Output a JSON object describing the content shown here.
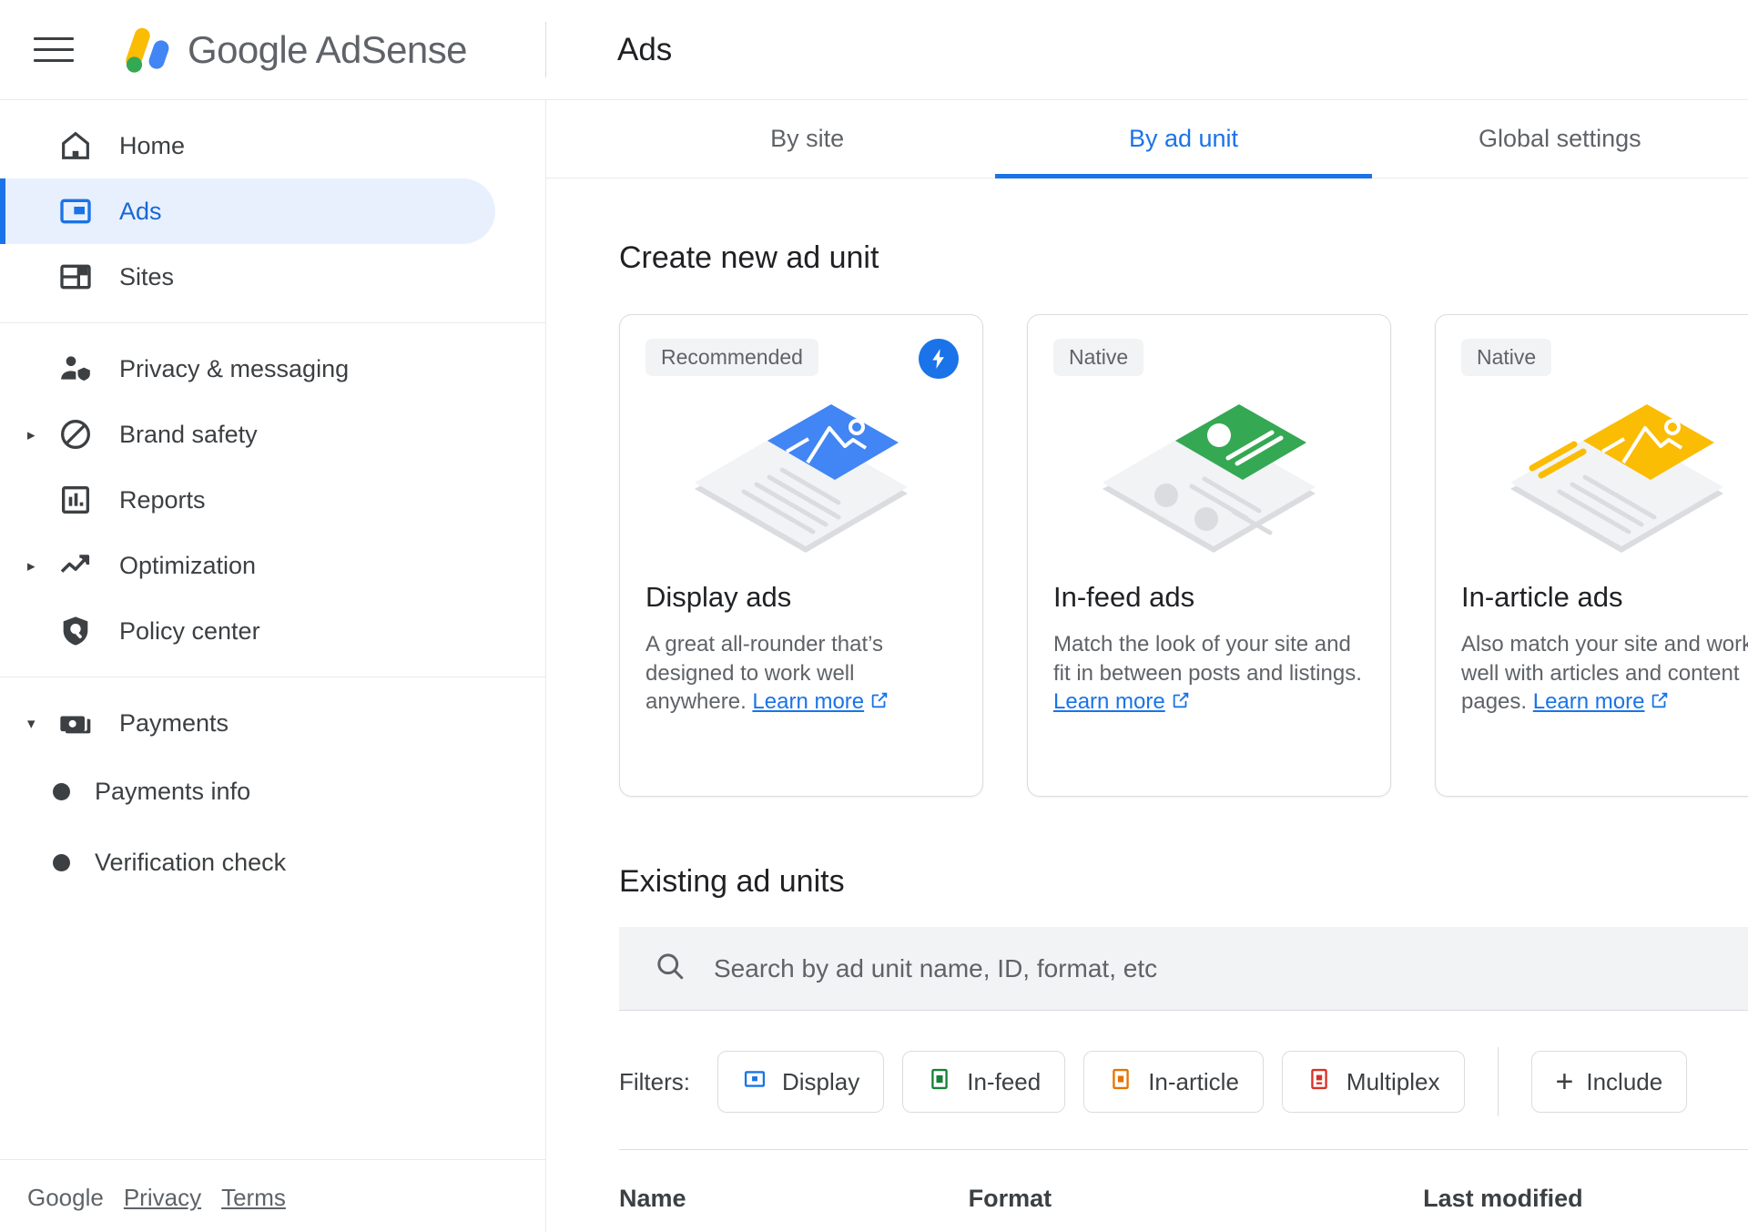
{
  "app": {
    "brand_name": "Google AdSense",
    "menu_icon": "hamburger-menu-icon",
    "logo_icon": "adsense-logo-icon"
  },
  "header": {
    "page_title": "Ads"
  },
  "sidebar": {
    "items": [
      {
        "label": "Home",
        "icon": "home-icon",
        "active": false,
        "expandable": false
      },
      {
        "label": "Ads",
        "icon": "ads-icon",
        "active": true,
        "expandable": false
      },
      {
        "label": "Sites",
        "icon": "sites-icon",
        "active": false,
        "expandable": false
      },
      {
        "label": "Privacy & messaging",
        "icon": "privacy-person-shield-icon",
        "active": false,
        "expandable": false
      },
      {
        "label": "Brand safety",
        "icon": "block-circle-icon",
        "active": false,
        "expandable": true,
        "expanded": false
      },
      {
        "label": "Reports",
        "icon": "bar-chart-icon",
        "active": false,
        "expandable": false
      },
      {
        "label": "Optimization",
        "icon": "trending-up-icon",
        "active": false,
        "expandable": true,
        "expanded": false
      },
      {
        "label": "Policy center",
        "icon": "shield-search-icon",
        "active": false,
        "expandable": false
      },
      {
        "label": "Payments",
        "icon": "money-bill-icon",
        "active": false,
        "expandable": true,
        "expanded": true
      }
    ],
    "payments_subitems": [
      {
        "label": "Payments info"
      },
      {
        "label": "Verification check"
      }
    ],
    "footer": {
      "google": "Google",
      "privacy": "Privacy",
      "terms": "Terms"
    }
  },
  "tabs": [
    {
      "label": "By site",
      "active": false
    },
    {
      "label": "By ad unit",
      "active": true
    },
    {
      "label": "Global settings",
      "active": false
    }
  ],
  "main": {
    "create_section_title": "Create new ad unit",
    "cards": [
      {
        "tag": "Recommended",
        "badge_icon": "lightning-bolt-icon",
        "title": "Display ads",
        "desc_pre": "A great all-rounder that’s designed to work well anywhere. ",
        "link": "Learn more",
        "illustration": "display-ads-isometric-icon",
        "accent": "#4285f4"
      },
      {
        "tag": "Native",
        "badge_icon": "",
        "title": "In-feed ads",
        "desc_pre": "Match the look of your site and fit in between posts and listings. ",
        "link": "Learn more",
        "illustration": "in-feed-ads-isometric-icon",
        "accent": "#34a853"
      },
      {
        "tag": "Native",
        "badge_icon": "",
        "title": "In-article ads",
        "desc_pre": "Also match your site and work well with articles and content pages. ",
        "link": "Learn more",
        "illustration": "in-article-ads-isometric-icon",
        "accent": "#fbbc04"
      }
    ],
    "existing_section_title": "Existing ad units",
    "search": {
      "placeholder": "Search by ad unit name, ID, format, etc",
      "value": "",
      "icon": "search-icon"
    },
    "filters": {
      "label": "Filters:",
      "chips": [
        {
          "label": "Display",
          "icon": "display-format-icon",
          "color": "#1a73e8"
        },
        {
          "label": "In-feed",
          "icon": "in-feed-format-icon",
          "color": "#188038"
        },
        {
          "label": "In-article",
          "icon": "in-article-format-icon",
          "color": "#e37400"
        },
        {
          "label": "Multiplex",
          "icon": "multiplex-format-icon",
          "color": "#d93025"
        }
      ],
      "add_label": "Include",
      "add_icon": "plus-icon"
    },
    "table_headers": [
      {
        "label": "Name"
      },
      {
        "label": "Format"
      },
      {
        "label": "Last modified"
      }
    ]
  },
  "colors": {
    "accent_blue": "#1a73e8",
    "active_nav_bg": "#e8f0fe",
    "google_yellow": "#fbbc04",
    "google_green": "#34a853",
    "google_blue": "#4285f4",
    "google_red": "#ea4335"
  }
}
